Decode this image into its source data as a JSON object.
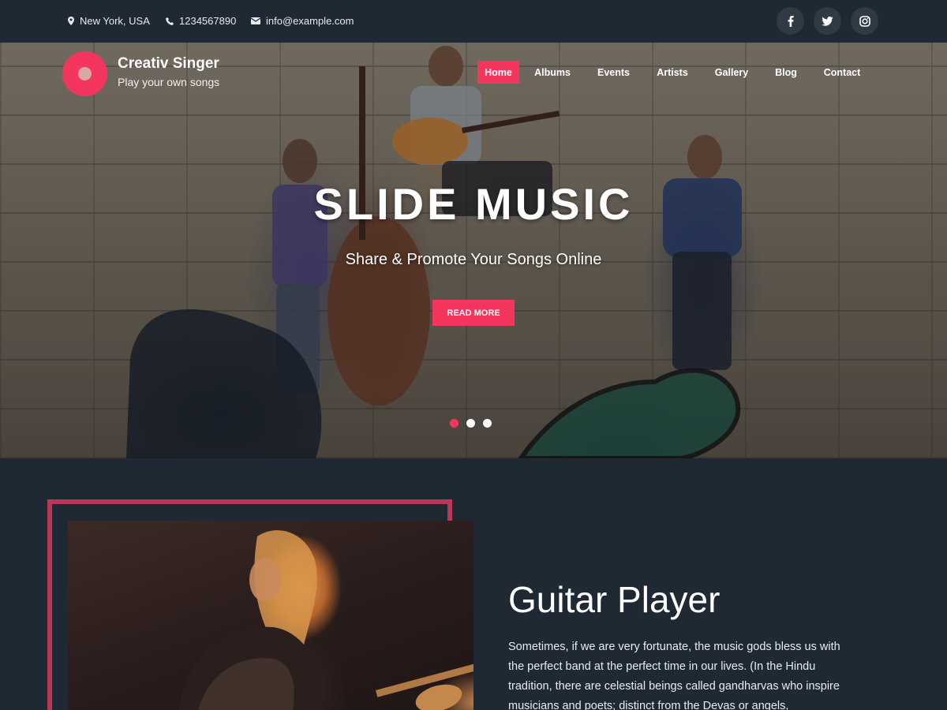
{
  "topbar": {
    "location": "New York, USA",
    "phone": "1234567890",
    "email": "info@example.com",
    "social": [
      "facebook-icon",
      "twitter-icon",
      "instagram-icon"
    ]
  },
  "brand": {
    "title": "Creativ Singer",
    "tagline": "Play your own songs",
    "accent": "#f4365f"
  },
  "nav": {
    "items": [
      {
        "label": "Home",
        "active": true
      },
      {
        "label": "Albums"
      },
      {
        "label": "Events"
      },
      {
        "label": "Artists"
      },
      {
        "label": "Gallery"
      },
      {
        "label": "Blog"
      },
      {
        "label": "Contact"
      }
    ]
  },
  "hero": {
    "title": "SLIDE MUSIC",
    "subtitle": "Share & Promote Your Songs Online",
    "button_label": "READ MORE",
    "slides": 3,
    "active_slide": 1
  },
  "about": {
    "title": "Guitar Player",
    "text": "Sometimes, if we are very fortunate, the music gods bless us with the perfect band at the perfect time in our lives. (In the Hindu tradition, there are celestial beings called gandharvas who inspire musicians and poets; distinct from the Devas or angels,"
  },
  "colors": {
    "background": "#1f2934",
    "accent": "#f4365f",
    "frame": "#b9385a"
  }
}
